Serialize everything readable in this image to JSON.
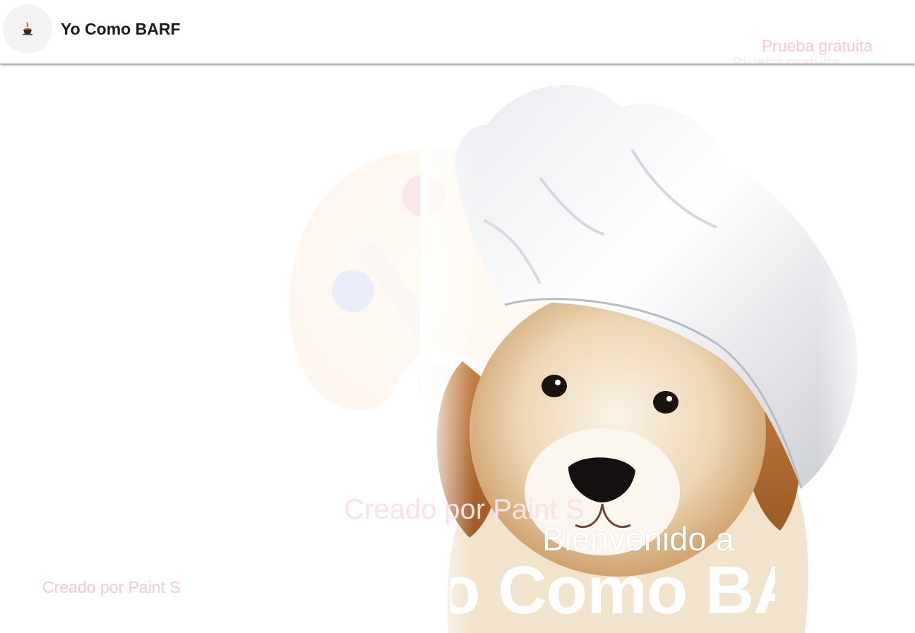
{
  "header": {
    "logo_icon": "cooking-pot-icon",
    "brand": "Yo Como BARF",
    "trial_link": "Prueba gratuita"
  },
  "hero": {
    "image": "puppy-with-chef-hat",
    "watermark": "Creado por Paint S",
    "credit": "Creado por Paint S",
    "welcome": "Bienvenido a",
    "headline": "Yo Como BARF"
  },
  "colors": {
    "accent_pink": "#f8c9cc",
    "text_dark": "#1c1c1c",
    "hero_text": "#ffffff"
  }
}
